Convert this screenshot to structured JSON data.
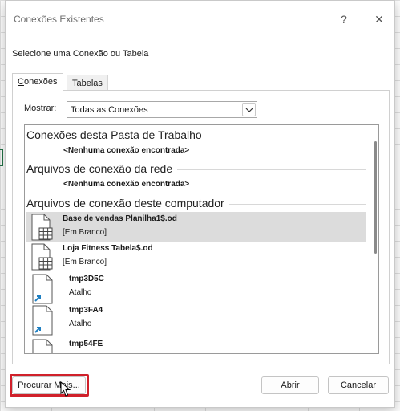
{
  "dialog": {
    "title": "Conexões Existentes",
    "help_label": "?",
    "close_label": "✕",
    "prompt": "Selecione uma Conexão ou Tabela"
  },
  "tabs": [
    {
      "label_u": "C",
      "label_rest": "onexões",
      "active": true
    },
    {
      "label_u": "T",
      "label_rest": "abelas",
      "active": false
    }
  ],
  "filter": {
    "label_u": "M",
    "label_rest": "ostrar:",
    "value": "Todas as Conexões"
  },
  "sections": [
    {
      "header": "Conexões desta Pasta de Trabalho",
      "empty": "<Nenhuma conexão encontrada>"
    },
    {
      "header": "Arquivos de conexão da rede",
      "empty": "<Nenhuma conexão encontrada>"
    },
    {
      "header": "Arquivos de conexão deste computador"
    }
  ],
  "items": [
    {
      "name": "Base de vendas Planilha1$.od",
      "desc": "[Em Branco]",
      "icon": "table-file-icon",
      "selected": true
    },
    {
      "name": "Loja Fitness Tabela$.od",
      "desc": "[Em Branco]",
      "icon": "table-file-icon",
      "selected": false
    },
    {
      "name": "tmp3D5C",
      "desc": "Atalho",
      "icon": "shortcut-file-icon",
      "selected": false
    },
    {
      "name": "tmp3FA4",
      "desc": "Atalho",
      "icon": "shortcut-file-icon",
      "selected": false
    },
    {
      "name": "tmp54FE",
      "desc": "",
      "icon": "shortcut-file-icon",
      "selected": false
    }
  ],
  "buttons": {
    "browse_u": "P",
    "browse_rest": "rocurar Mais...",
    "open_u": "A",
    "open_rest": "brir",
    "cancel": "Cancelar"
  },
  "colors": {
    "highlight_border": "#d0202a",
    "selected_row": "#dcdcdc",
    "shortcut_arrow": "#1e7fc2"
  }
}
